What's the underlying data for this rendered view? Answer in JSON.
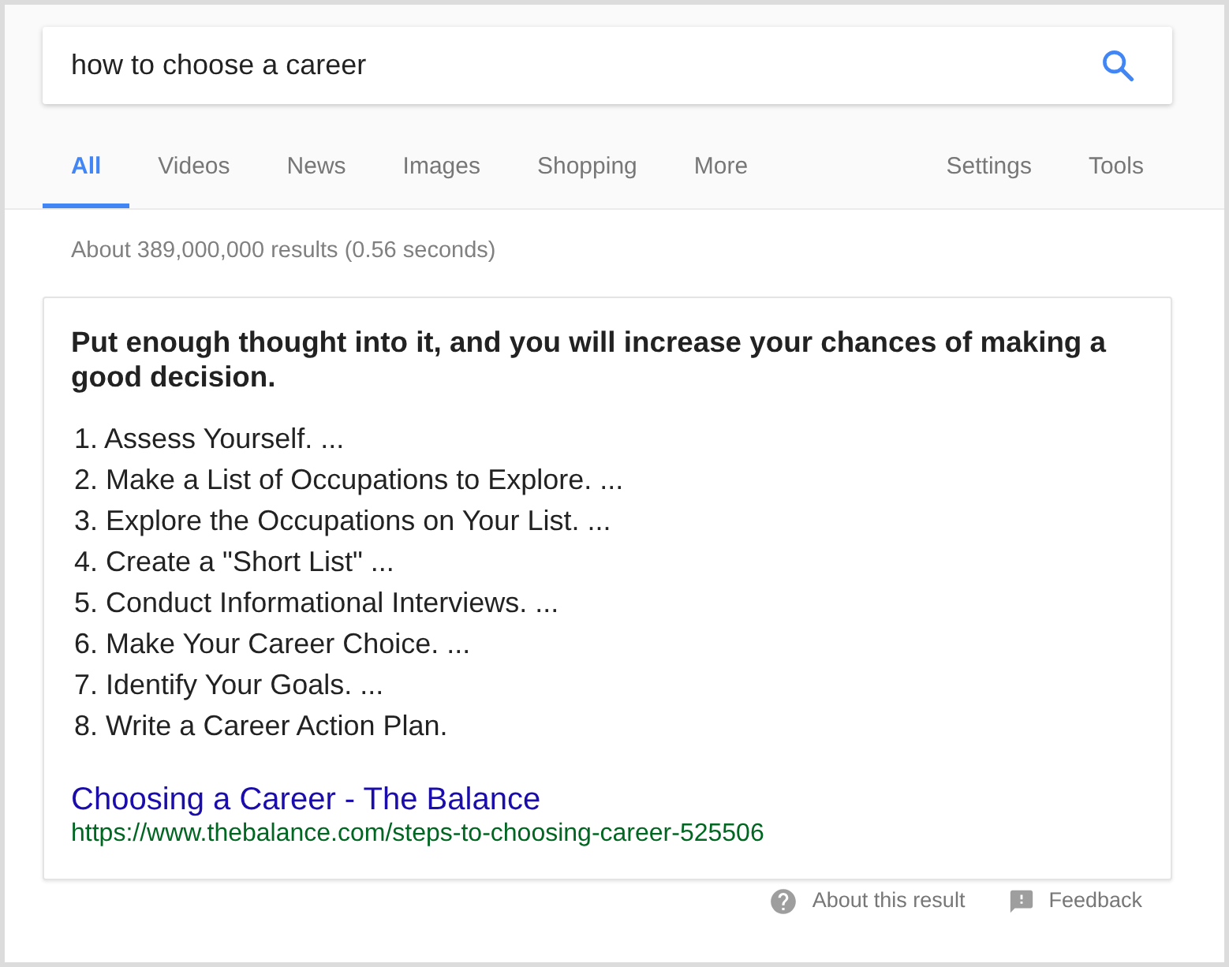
{
  "search": {
    "value": "how to choose a career"
  },
  "tabs": [
    {
      "label": "All",
      "selected": true
    },
    {
      "label": "Videos",
      "selected": false
    },
    {
      "label": "News",
      "selected": false
    },
    {
      "label": "Images",
      "selected": false
    },
    {
      "label": "Shopping",
      "selected": false
    },
    {
      "label": "More",
      "selected": false
    }
  ],
  "tools": [
    {
      "label": "Settings"
    },
    {
      "label": "Tools"
    }
  ],
  "result_stats": "About 389,000,000 results (0.56 seconds)",
  "featured_snippet": {
    "heading": "Put enough thought into it, and you will increase your chances of making a good decision.",
    "steps": [
      "1. Assess Yourself. ...",
      "2. Make a List of Occupations to Explore. ...",
      "3. Explore the Occupations on Your List. ...",
      "4. Create a \"Short List\" ...",
      "5. Conduct Informational Interviews. ...",
      "6. Make Your Career Choice. ...",
      "7. Identify Your Goals. ...",
      "8. Write a Career Action Plan."
    ],
    "source_title": "Choosing a Career - The Balance",
    "source_url": "https://www.thebalance.com/steps-to-choosing-career-525506"
  },
  "footer_links": [
    {
      "kind": "about",
      "label": "About this result"
    },
    {
      "kind": "feedback",
      "label": "Feedback"
    }
  ]
}
